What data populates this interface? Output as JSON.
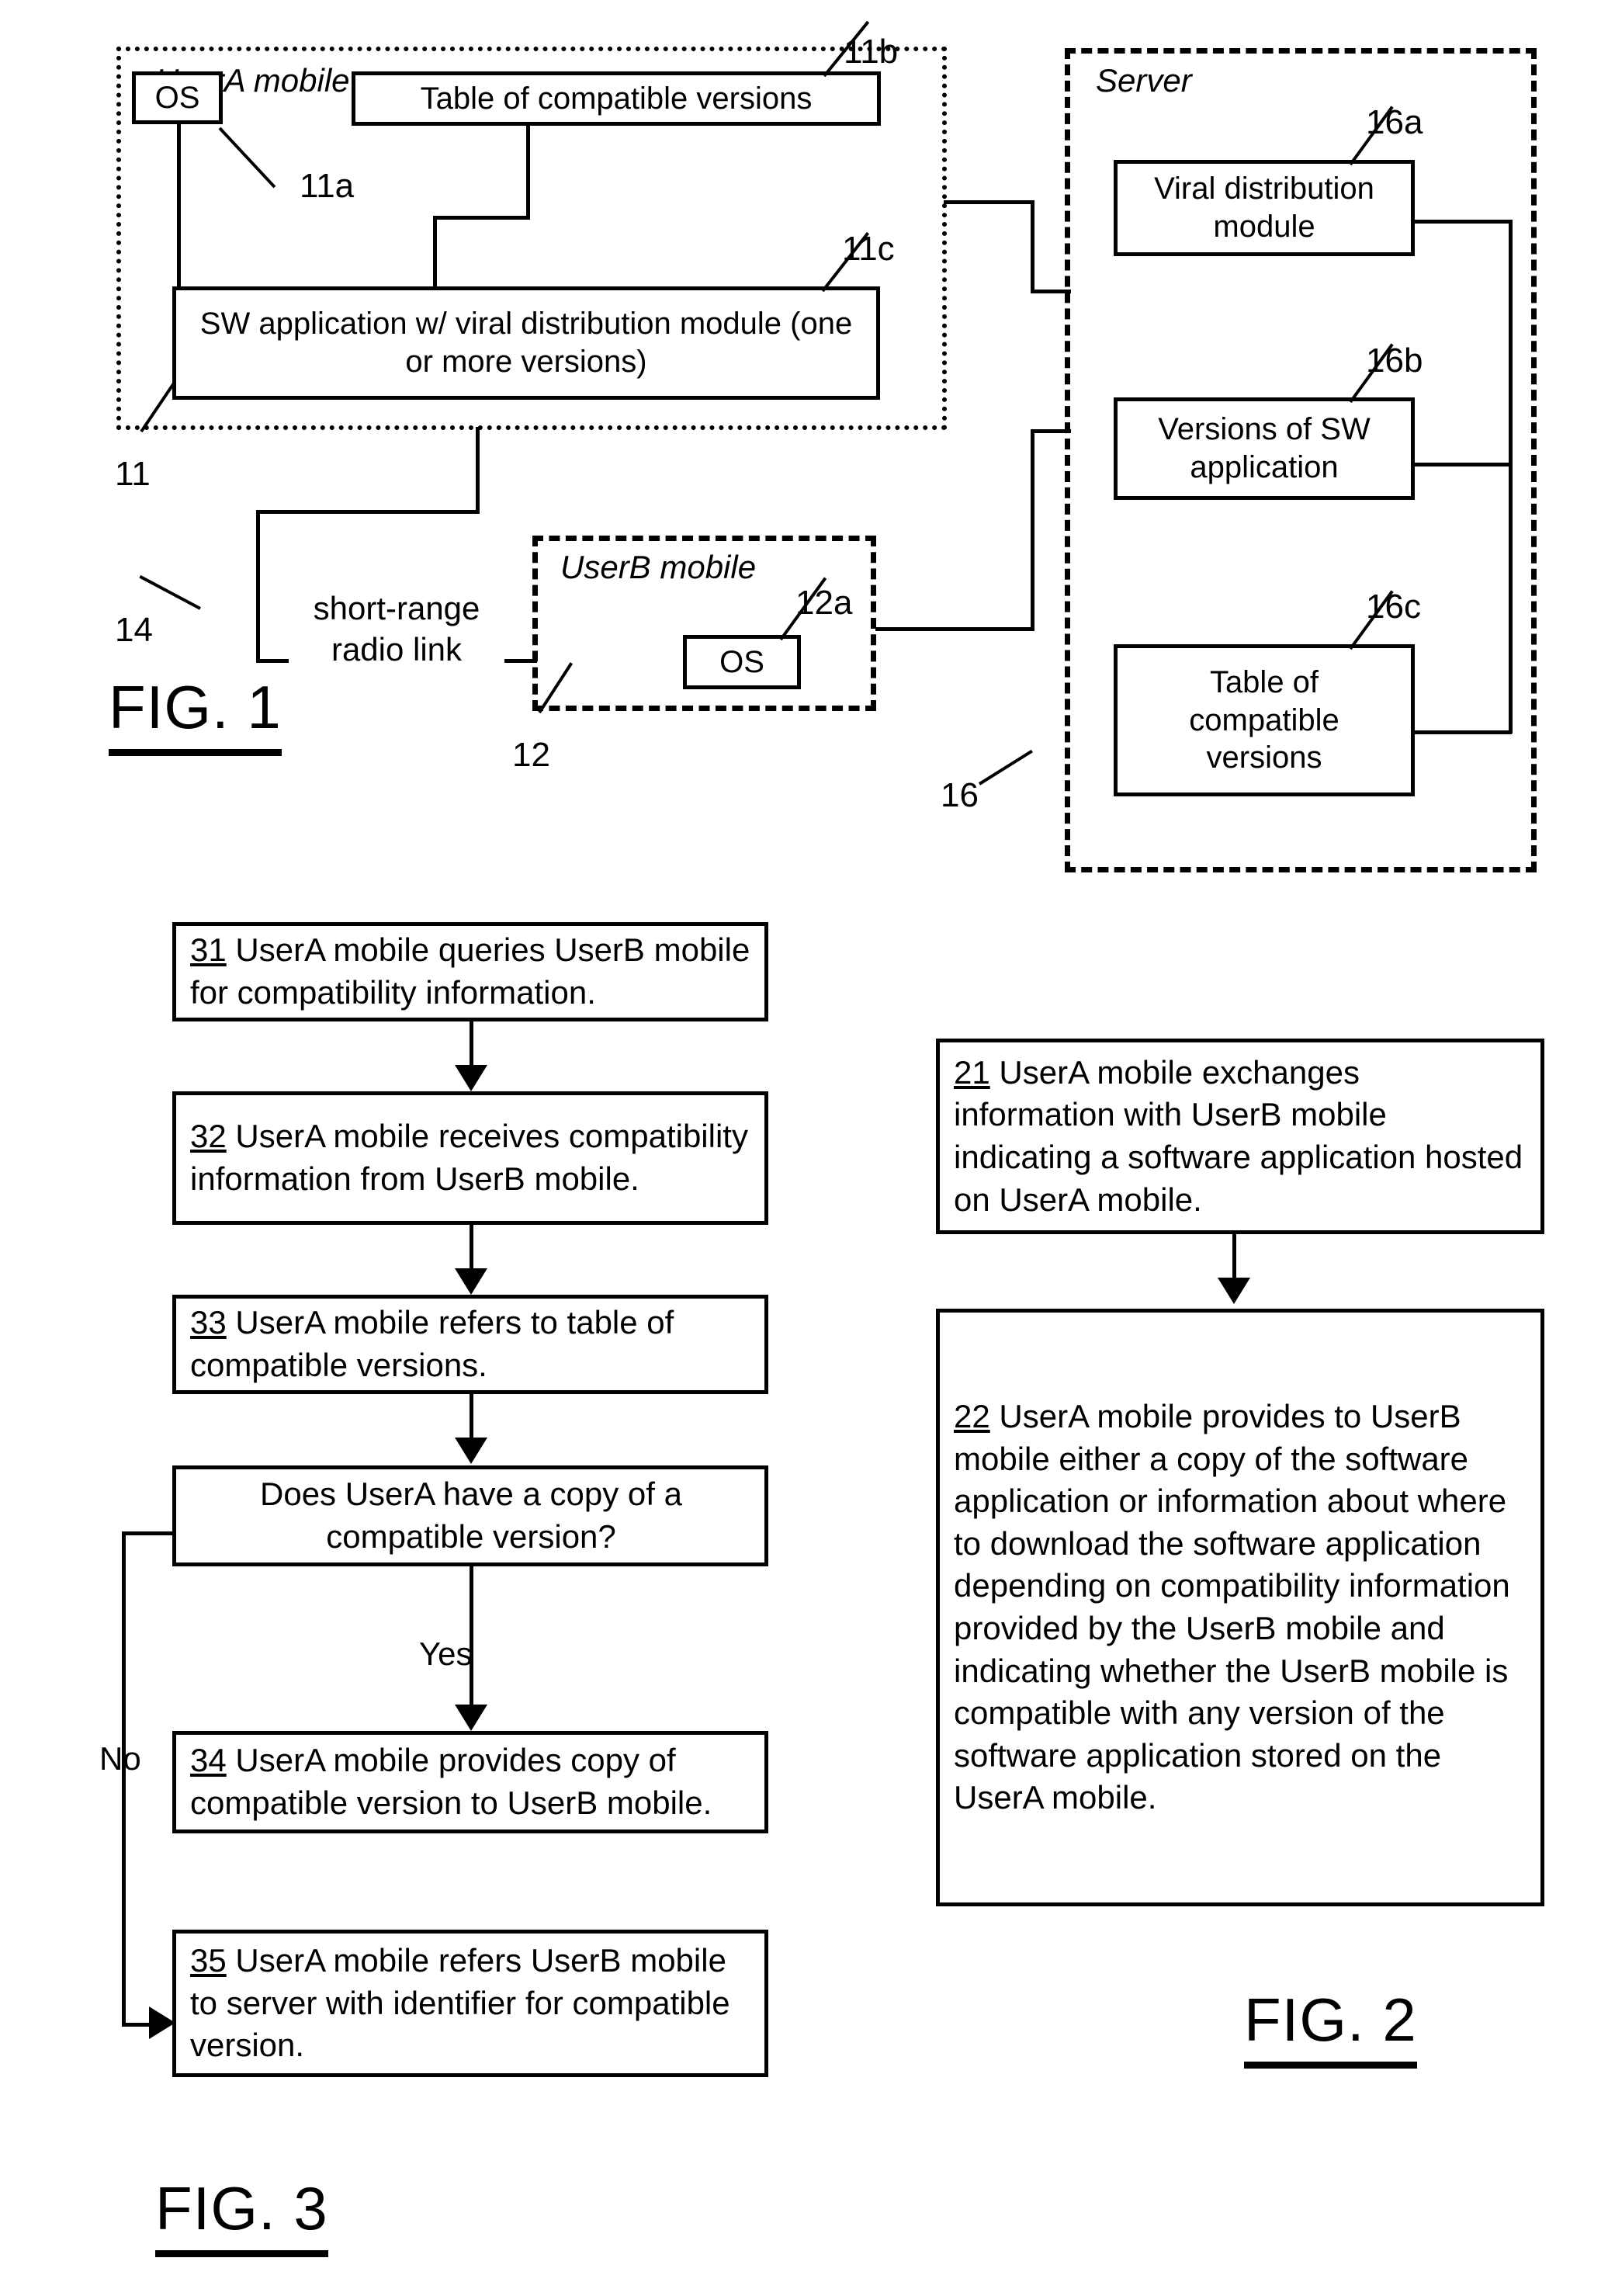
{
  "figures": {
    "fig1": {
      "caption": "FIG. 1",
      "enclosures": [
        {
          "id": "userA",
          "label": "UserA mobile",
          "ref": "11",
          "style": "dotted"
        },
        {
          "id": "userB",
          "label": "UserB mobile",
          "ref": "12",
          "style": "dashed"
        },
        {
          "id": "server",
          "label": "Server",
          "ref": "16",
          "style": "dash-dot"
        }
      ],
      "boxes": [
        {
          "id": "os_a",
          "text": "OS",
          "ref": "11a"
        },
        {
          "id": "table_a",
          "text": "Table of compatible versions",
          "ref": "11b"
        },
        {
          "id": "swapp_a",
          "text": "SW application w/ viral distribution module (one or more versions)",
          "ref": "11c"
        },
        {
          "id": "os_b",
          "text": "OS",
          "ref": "12a"
        },
        {
          "id": "viral_mod",
          "text": "Viral distribution module",
          "ref": "16a"
        },
        {
          "id": "versions_sw",
          "text": "Versions of SW application",
          "ref": "16b"
        },
        {
          "id": "table_s",
          "text": "Table of compatible versions",
          "ref": "16c"
        }
      ],
      "link_label": "short-range radio link",
      "link_ref": "14"
    },
    "fig2": {
      "caption": "FIG. 2",
      "steps": [
        {
          "num": "21",
          "text": "UserA mobile exchanges information with UserB mobile indicating a software application hosted on UserA mobile."
        },
        {
          "num": "22",
          "text": "UserA mobile provides to UserB mobile either a copy of the software application or information about where to download the software application depending on compatibility information provided by the UserB mobile and indicating whether the UserB mobile is compatible with any version of the software application stored on the UserA mobile."
        }
      ]
    },
    "fig3": {
      "caption": "FIG. 3",
      "steps": [
        {
          "num": "31",
          "text": "UserA mobile queries UserB mobile for compatibility information."
        },
        {
          "num": "32",
          "text": "UserA mobile receives compatibility information from UserB mobile."
        },
        {
          "num": "33",
          "text": "UserA mobile refers to table of compatible versions."
        },
        {
          "num": "34",
          "text": "UserA mobile provides copy of compatible version to UserB mobile."
        },
        {
          "num": "35",
          "text": "UserA mobile refers UserB mobile to server with identifier for compatible version."
        }
      ],
      "decision": {
        "text": "Does UserA have a copy of a compatible version?"
      },
      "branch_yes": "Yes",
      "branch_no": "No"
    }
  },
  "colors": {
    "ink": "#000000",
    "paper": "#ffffff"
  }
}
